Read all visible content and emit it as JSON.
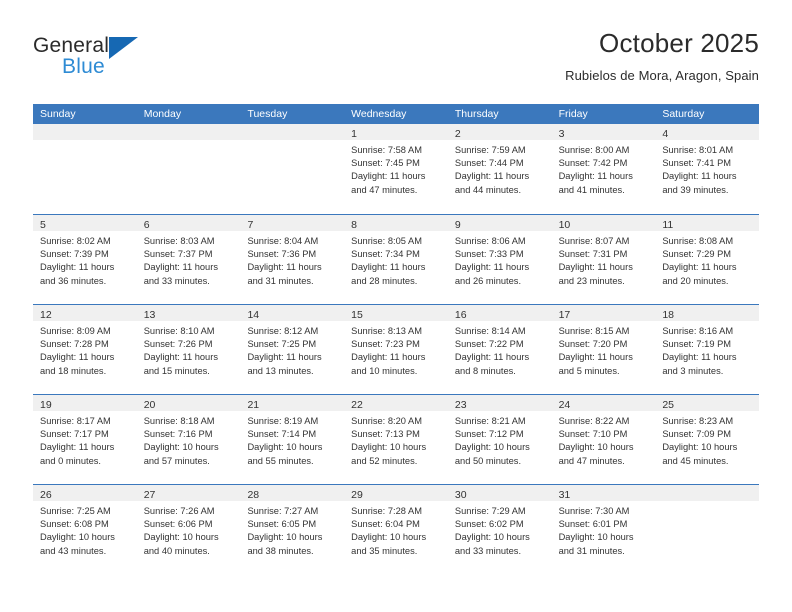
{
  "logo": {
    "word_top": "General",
    "word_bottom": "Blue",
    "triangle_icon": "blue-triangle-icon",
    "accent_dark": "#2b2b2b",
    "accent_blue": "#2e8bd4"
  },
  "header": {
    "title": "October 2025",
    "subtitle": "Rubielos de Mora, Aragon, Spain"
  },
  "colors": {
    "header_bar": "#3b78bd",
    "day_band": "#f0f0f0",
    "text": "#333333",
    "page_bg": "#ffffff"
  },
  "weekdays": [
    "Sunday",
    "Monday",
    "Tuesday",
    "Wednesday",
    "Thursday",
    "Friday",
    "Saturday"
  ],
  "weeks": [
    [
      {
        "day": "",
        "empty": true,
        "sunrise": "",
        "sunset": "",
        "daylight_line1": "",
        "daylight_line2": ""
      },
      {
        "day": "",
        "empty": true,
        "sunrise": "",
        "sunset": "",
        "daylight_line1": "",
        "daylight_line2": ""
      },
      {
        "day": "",
        "empty": true,
        "sunrise": "",
        "sunset": "",
        "daylight_line1": "",
        "daylight_line2": ""
      },
      {
        "day": "1",
        "empty": false,
        "sunrise": "Sunrise: 7:58 AM",
        "sunset": "Sunset: 7:45 PM",
        "daylight_line1": "Daylight: 11 hours",
        "daylight_line2": "and 47 minutes."
      },
      {
        "day": "2",
        "empty": false,
        "sunrise": "Sunrise: 7:59 AM",
        "sunset": "Sunset: 7:44 PM",
        "daylight_line1": "Daylight: 11 hours",
        "daylight_line2": "and 44 minutes."
      },
      {
        "day": "3",
        "empty": false,
        "sunrise": "Sunrise: 8:00 AM",
        "sunset": "Sunset: 7:42 PM",
        "daylight_line1": "Daylight: 11 hours",
        "daylight_line2": "and 41 minutes."
      },
      {
        "day": "4",
        "empty": false,
        "sunrise": "Sunrise: 8:01 AM",
        "sunset": "Sunset: 7:41 PM",
        "daylight_line1": "Daylight: 11 hours",
        "daylight_line2": "and 39 minutes."
      }
    ],
    [
      {
        "day": "5",
        "empty": false,
        "sunrise": "Sunrise: 8:02 AM",
        "sunset": "Sunset: 7:39 PM",
        "daylight_line1": "Daylight: 11 hours",
        "daylight_line2": "and 36 minutes."
      },
      {
        "day": "6",
        "empty": false,
        "sunrise": "Sunrise: 8:03 AM",
        "sunset": "Sunset: 7:37 PM",
        "daylight_line1": "Daylight: 11 hours",
        "daylight_line2": "and 33 minutes."
      },
      {
        "day": "7",
        "empty": false,
        "sunrise": "Sunrise: 8:04 AM",
        "sunset": "Sunset: 7:36 PM",
        "daylight_line1": "Daylight: 11 hours",
        "daylight_line2": "and 31 minutes."
      },
      {
        "day": "8",
        "empty": false,
        "sunrise": "Sunrise: 8:05 AM",
        "sunset": "Sunset: 7:34 PM",
        "daylight_line1": "Daylight: 11 hours",
        "daylight_line2": "and 28 minutes."
      },
      {
        "day": "9",
        "empty": false,
        "sunrise": "Sunrise: 8:06 AM",
        "sunset": "Sunset: 7:33 PM",
        "daylight_line1": "Daylight: 11 hours",
        "daylight_line2": "and 26 minutes."
      },
      {
        "day": "10",
        "empty": false,
        "sunrise": "Sunrise: 8:07 AM",
        "sunset": "Sunset: 7:31 PM",
        "daylight_line1": "Daylight: 11 hours",
        "daylight_line2": "and 23 minutes."
      },
      {
        "day": "11",
        "empty": false,
        "sunrise": "Sunrise: 8:08 AM",
        "sunset": "Sunset: 7:29 PM",
        "daylight_line1": "Daylight: 11 hours",
        "daylight_line2": "and 20 minutes."
      }
    ],
    [
      {
        "day": "12",
        "empty": false,
        "sunrise": "Sunrise: 8:09 AM",
        "sunset": "Sunset: 7:28 PM",
        "daylight_line1": "Daylight: 11 hours",
        "daylight_line2": "and 18 minutes."
      },
      {
        "day": "13",
        "empty": false,
        "sunrise": "Sunrise: 8:10 AM",
        "sunset": "Sunset: 7:26 PM",
        "daylight_line1": "Daylight: 11 hours",
        "daylight_line2": "and 15 minutes."
      },
      {
        "day": "14",
        "empty": false,
        "sunrise": "Sunrise: 8:12 AM",
        "sunset": "Sunset: 7:25 PM",
        "daylight_line1": "Daylight: 11 hours",
        "daylight_line2": "and 13 minutes."
      },
      {
        "day": "15",
        "empty": false,
        "sunrise": "Sunrise: 8:13 AM",
        "sunset": "Sunset: 7:23 PM",
        "daylight_line1": "Daylight: 11 hours",
        "daylight_line2": "and 10 minutes."
      },
      {
        "day": "16",
        "empty": false,
        "sunrise": "Sunrise: 8:14 AM",
        "sunset": "Sunset: 7:22 PM",
        "daylight_line1": "Daylight: 11 hours",
        "daylight_line2": "and 8 minutes."
      },
      {
        "day": "17",
        "empty": false,
        "sunrise": "Sunrise: 8:15 AM",
        "sunset": "Sunset: 7:20 PM",
        "daylight_line1": "Daylight: 11 hours",
        "daylight_line2": "and 5 minutes."
      },
      {
        "day": "18",
        "empty": false,
        "sunrise": "Sunrise: 8:16 AM",
        "sunset": "Sunset: 7:19 PM",
        "daylight_line1": "Daylight: 11 hours",
        "daylight_line2": "and 3 minutes."
      }
    ],
    [
      {
        "day": "19",
        "empty": false,
        "sunrise": "Sunrise: 8:17 AM",
        "sunset": "Sunset: 7:17 PM",
        "daylight_line1": "Daylight: 11 hours",
        "daylight_line2": "and 0 minutes."
      },
      {
        "day": "20",
        "empty": false,
        "sunrise": "Sunrise: 8:18 AM",
        "sunset": "Sunset: 7:16 PM",
        "daylight_line1": "Daylight: 10 hours",
        "daylight_line2": "and 57 minutes."
      },
      {
        "day": "21",
        "empty": false,
        "sunrise": "Sunrise: 8:19 AM",
        "sunset": "Sunset: 7:14 PM",
        "daylight_line1": "Daylight: 10 hours",
        "daylight_line2": "and 55 minutes."
      },
      {
        "day": "22",
        "empty": false,
        "sunrise": "Sunrise: 8:20 AM",
        "sunset": "Sunset: 7:13 PM",
        "daylight_line1": "Daylight: 10 hours",
        "daylight_line2": "and 52 minutes."
      },
      {
        "day": "23",
        "empty": false,
        "sunrise": "Sunrise: 8:21 AM",
        "sunset": "Sunset: 7:12 PM",
        "daylight_line1": "Daylight: 10 hours",
        "daylight_line2": "and 50 minutes."
      },
      {
        "day": "24",
        "empty": false,
        "sunrise": "Sunrise: 8:22 AM",
        "sunset": "Sunset: 7:10 PM",
        "daylight_line1": "Daylight: 10 hours",
        "daylight_line2": "and 47 minutes."
      },
      {
        "day": "25",
        "empty": false,
        "sunrise": "Sunrise: 8:23 AM",
        "sunset": "Sunset: 7:09 PM",
        "daylight_line1": "Daylight: 10 hours",
        "daylight_line2": "and 45 minutes."
      }
    ],
    [
      {
        "day": "26",
        "empty": false,
        "sunrise": "Sunrise: 7:25 AM",
        "sunset": "Sunset: 6:08 PM",
        "daylight_line1": "Daylight: 10 hours",
        "daylight_line2": "and 43 minutes."
      },
      {
        "day": "27",
        "empty": false,
        "sunrise": "Sunrise: 7:26 AM",
        "sunset": "Sunset: 6:06 PM",
        "daylight_line1": "Daylight: 10 hours",
        "daylight_line2": "and 40 minutes."
      },
      {
        "day": "28",
        "empty": false,
        "sunrise": "Sunrise: 7:27 AM",
        "sunset": "Sunset: 6:05 PM",
        "daylight_line1": "Daylight: 10 hours",
        "daylight_line2": "and 38 minutes."
      },
      {
        "day": "29",
        "empty": false,
        "sunrise": "Sunrise: 7:28 AM",
        "sunset": "Sunset: 6:04 PM",
        "daylight_line1": "Daylight: 10 hours",
        "daylight_line2": "and 35 minutes."
      },
      {
        "day": "30",
        "empty": false,
        "sunrise": "Sunrise: 7:29 AM",
        "sunset": "Sunset: 6:02 PM",
        "daylight_line1": "Daylight: 10 hours",
        "daylight_line2": "and 33 minutes."
      },
      {
        "day": "31",
        "empty": false,
        "sunrise": "Sunrise: 7:30 AM",
        "sunset": "Sunset: 6:01 PM",
        "daylight_line1": "Daylight: 10 hours",
        "daylight_line2": "and 31 minutes."
      },
      {
        "day": "",
        "empty": true,
        "sunrise": "",
        "sunset": "",
        "daylight_line1": "",
        "daylight_line2": ""
      }
    ]
  ]
}
